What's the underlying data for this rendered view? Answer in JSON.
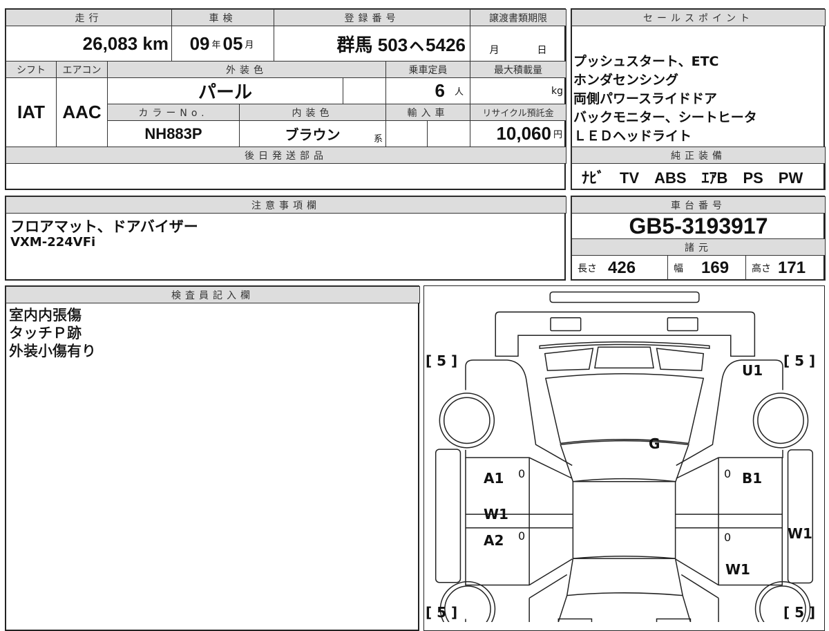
{
  "vehicle": {
    "headers": {
      "mileage": "走行",
      "inspection": "車検",
      "registration": "登録番号",
      "transfer_deadline": "譲渡書類期限",
      "shift": "シフト",
      "aircon": "エアコン",
      "exterior_color": "外装色",
      "capacity": "乗車定員",
      "max_load": "最大積載量",
      "color_no": "カラーNo.",
      "interior_color": "内装色",
      "import": "輸入車",
      "recycle_fee": "リサイクル預託金",
      "parts_later": "後日発送部品"
    },
    "mileage": "26,083",
    "mileage_unit": "km",
    "inspection_year": "09",
    "year_unit": "年",
    "inspection_month": "05",
    "month_unit": "月",
    "registration": "群馬 503ㇸ5426",
    "deadline_month": "月",
    "deadline_day": "日",
    "shift": "IAT",
    "aircon": "AAC",
    "exterior_color": "パール",
    "capacity": "6",
    "capacity_unit": "人",
    "load_unit": "kg",
    "color_no": "NH883P",
    "interior_color": "ブラウン",
    "interior_suffix": "系",
    "recycle_fee": "10,060",
    "yen": "円"
  },
  "sales_points": {
    "header": "セールスポイント",
    "lines": [
      "プッシュスタート、ETC",
      "ホンダセンシング",
      "両側パワースライドドア",
      "バックモニター、シートヒータ",
      "ＬＥＤヘッドライト"
    ]
  },
  "equipment": {
    "header": "純正装備",
    "items": "ﾅﾋﾞ　TV　ABS　ｴｱB　PS　PW"
  },
  "notes": {
    "header": "注意事項欄",
    "lines": [
      "フロアマット、ドアバイザー",
      "VXM-224VFi"
    ]
  },
  "chassis": {
    "header": "車台番号",
    "number": "GB5-3193917",
    "spec_header": "諸元",
    "length_label": "長さ",
    "length": "426",
    "width_label": "幅",
    "width": "169",
    "height_label": "高さ",
    "height": "171"
  },
  "inspector": {
    "header": "検査員記入欄",
    "lines": [
      "室内内張傷",
      "タッチＰ跡",
      "外装小傷有り"
    ]
  },
  "diagram": {
    "tire_fl": "[ 5 ]",
    "tire_fr": "[ 5 ]",
    "tire_rl": "[ 5 ]",
    "tire_rr": "[ 5 ]",
    "u1": "U1",
    "g": "G",
    "a1": "A1",
    "b1": "B1",
    "w1_left": "W1",
    "a2": "A2",
    "w1_right": "W1",
    "w1_rear": "W1",
    "zero": "0"
  }
}
